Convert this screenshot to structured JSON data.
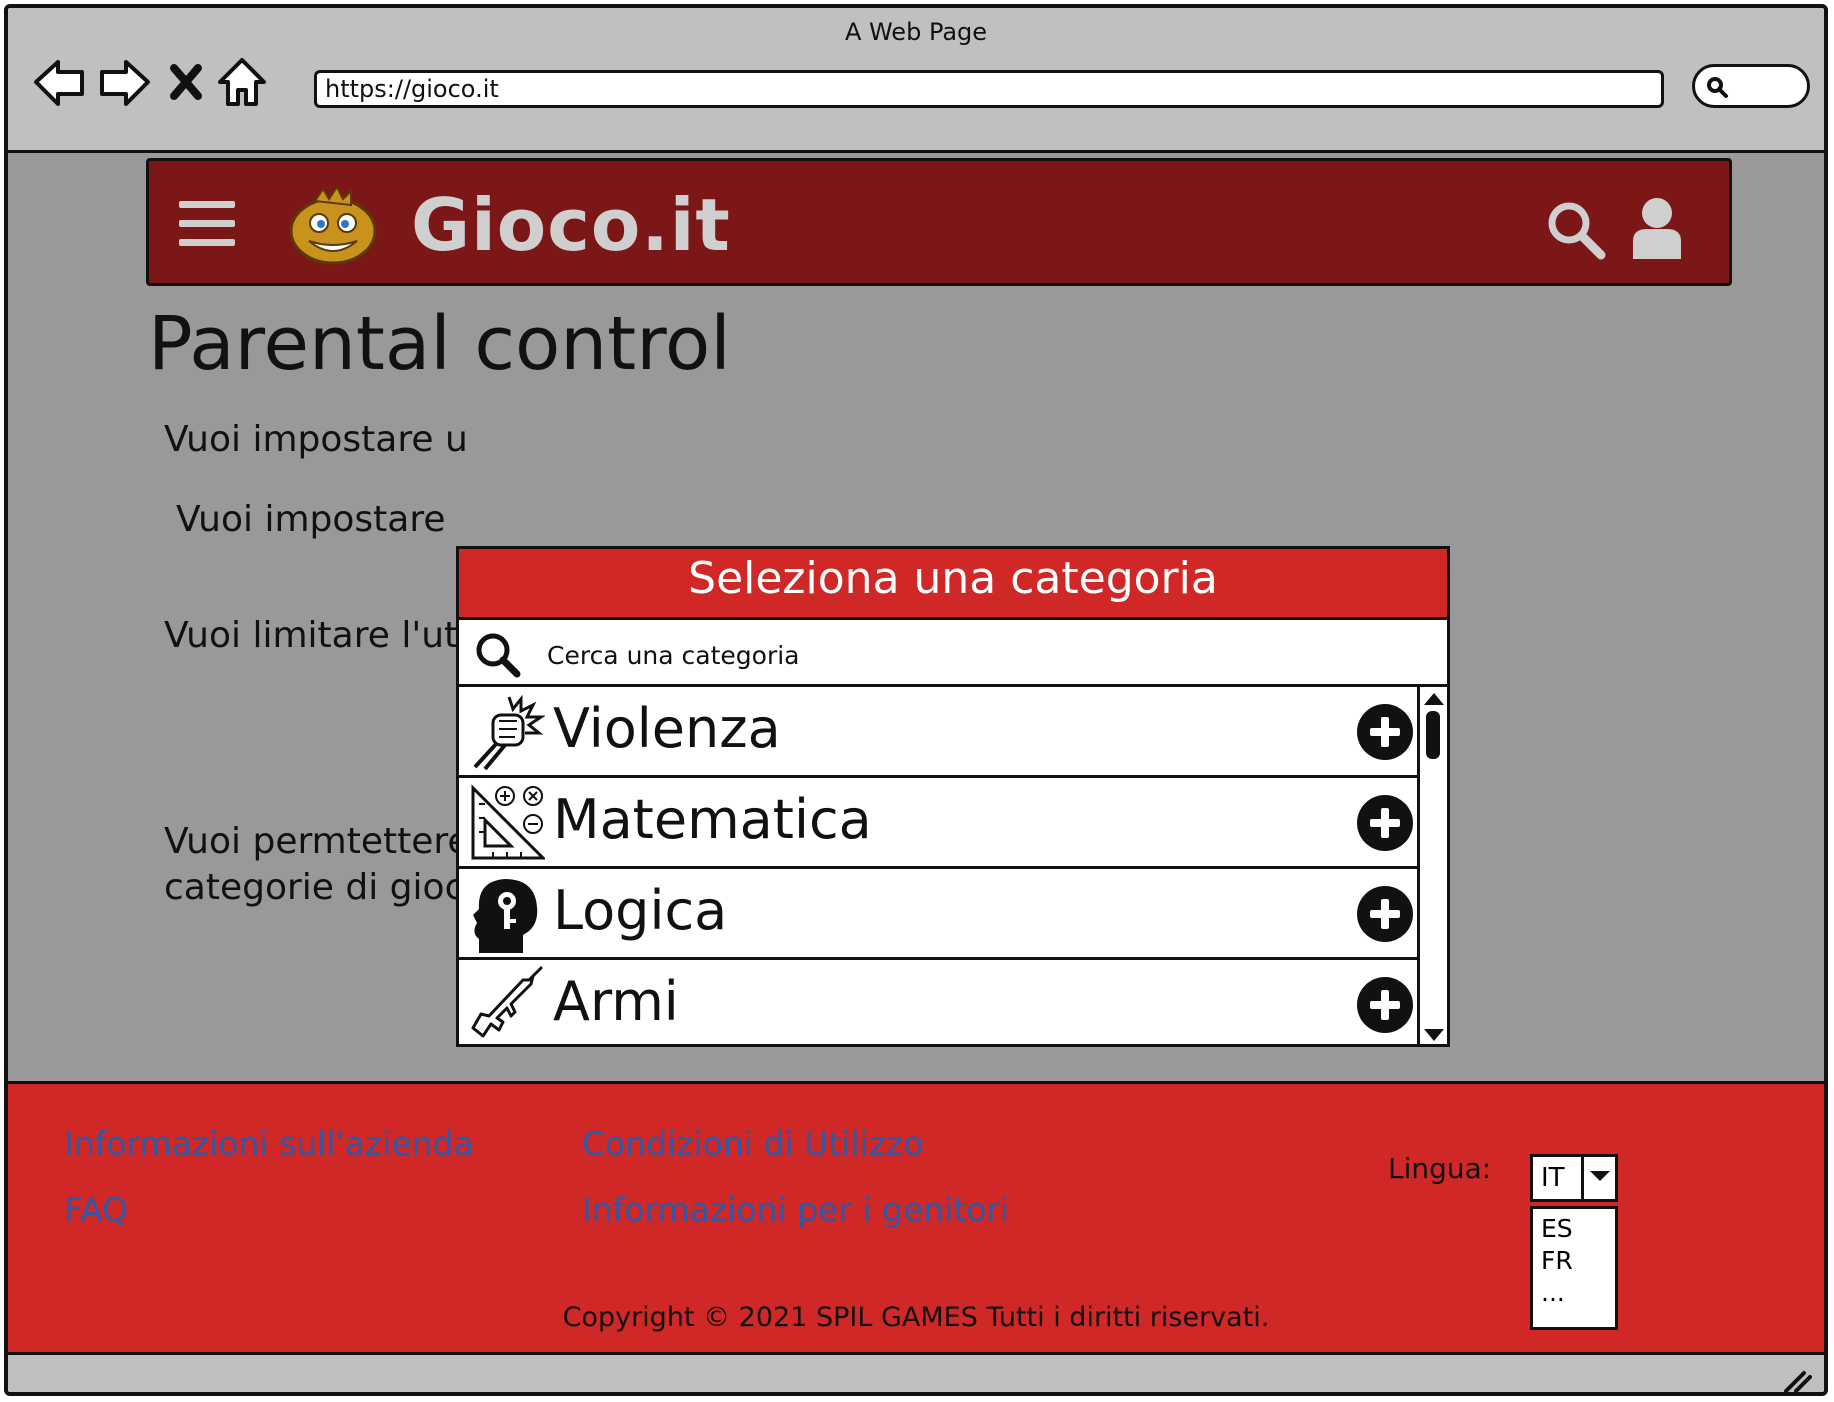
{
  "browser": {
    "window_title": "A Web Page",
    "url": "https://gioco.it"
  },
  "header": {
    "logo_text": "Gioco.it",
    "icons": [
      "menu-icon",
      "mascot-logo",
      "search-icon",
      "user-icon"
    ]
  },
  "page": {
    "title": "Parental control",
    "questions": [
      "Vuoi impostare u",
      "Vuoi impostare",
      "Vuoi limitare l'uti",
      "Vuoi permtettere",
      "categorie di giochi in particolare?"
    ]
  },
  "modal": {
    "title": "Seleziona una categoria",
    "search_placeholder": "Cerca una categoria",
    "categories": [
      {
        "label": "Violenza",
        "icon": "fist-icon"
      },
      {
        "label": "Matematica",
        "icon": "math-ruler-icon"
      },
      {
        "label": "Logica",
        "icon": "head-key-icon"
      },
      {
        "label": "Armi",
        "icon": "rifle-icon"
      }
    ]
  },
  "footer": {
    "links": {
      "about": "Informazioni sull'azienda",
      "terms": "Condizioni di Utilizzo",
      "faq": "FAQ",
      "parents": "Informazioni per i genitori"
    },
    "copyright": "Copyright © 2021 SPIL GAMES Tutti i diritti riservati.",
    "language_label": "Lingua:",
    "language_selected": "IT",
    "language_options": [
      "ES",
      "FR",
      "..."
    ]
  },
  "colors": {
    "header_bg": "#7b1716",
    "accent_red": "#d02727",
    "link_blue": "#2a5aa8",
    "overlay_gray": "#999999",
    "chrome_gray": "#c0c0c0"
  }
}
